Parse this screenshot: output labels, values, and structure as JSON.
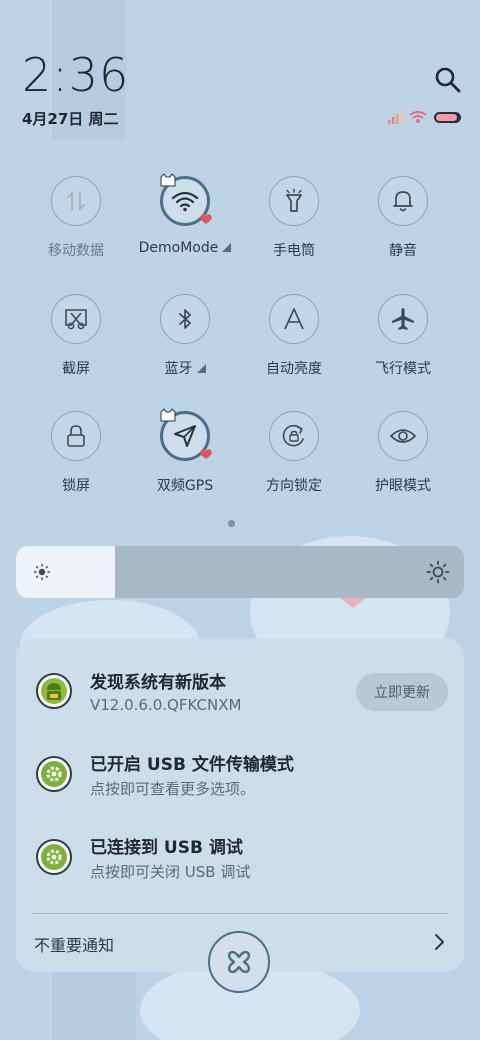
{
  "status": {
    "time": "2:36",
    "date": "4月27日 周二"
  },
  "tiles": [
    {
      "label": "移动数据",
      "icon": "mobile-data-icon",
      "active": false
    },
    {
      "label": "DemoMode",
      "icon": "wifi-icon",
      "active": true,
      "expandable": true
    },
    {
      "label": "手电筒",
      "icon": "flashlight-icon",
      "active": false
    },
    {
      "label": "静音",
      "icon": "bell-icon",
      "active": false
    },
    {
      "label": "截屏",
      "icon": "screenshot-icon",
      "active": false
    },
    {
      "label": "蓝牙",
      "icon": "bluetooth-icon",
      "active": false,
      "expandable": true
    },
    {
      "label": "自动亮度",
      "icon": "auto-brightness-icon",
      "active": false
    },
    {
      "label": "飞行模式",
      "icon": "airplane-icon",
      "active": false
    },
    {
      "label": "锁屏",
      "icon": "lock-icon",
      "active": false
    },
    {
      "label": "双频GPS",
      "icon": "gps-icon",
      "active": true
    },
    {
      "label": "方向锁定",
      "icon": "rotation-lock-icon",
      "active": false
    },
    {
      "label": "护眼模式",
      "icon": "eye-icon",
      "active": false
    }
  ],
  "pager": {
    "pages": 2,
    "current": 1
  },
  "brightness": {
    "level": 0.22
  },
  "notifications": [
    {
      "title": "发现系统有新版本",
      "subtitle": "V12.0.6.0.QFKCNXM",
      "action": "立即更新",
      "icon": "android-update-icon"
    },
    {
      "title": "已开启 USB 文件传输模式",
      "subtitle": "点按即可查看更多选项。",
      "icon": "settings-gear-icon"
    },
    {
      "title": "已连接到 USB 调试",
      "subtitle": "点按即可关闭 USB 调试",
      "icon": "settings-gear-icon"
    }
  ],
  "unimportant": {
    "label": "不重要通知"
  },
  "colors": {
    "background": "#bcd3e5",
    "accent": "#4c6f86",
    "panel": "#cedeeb"
  }
}
